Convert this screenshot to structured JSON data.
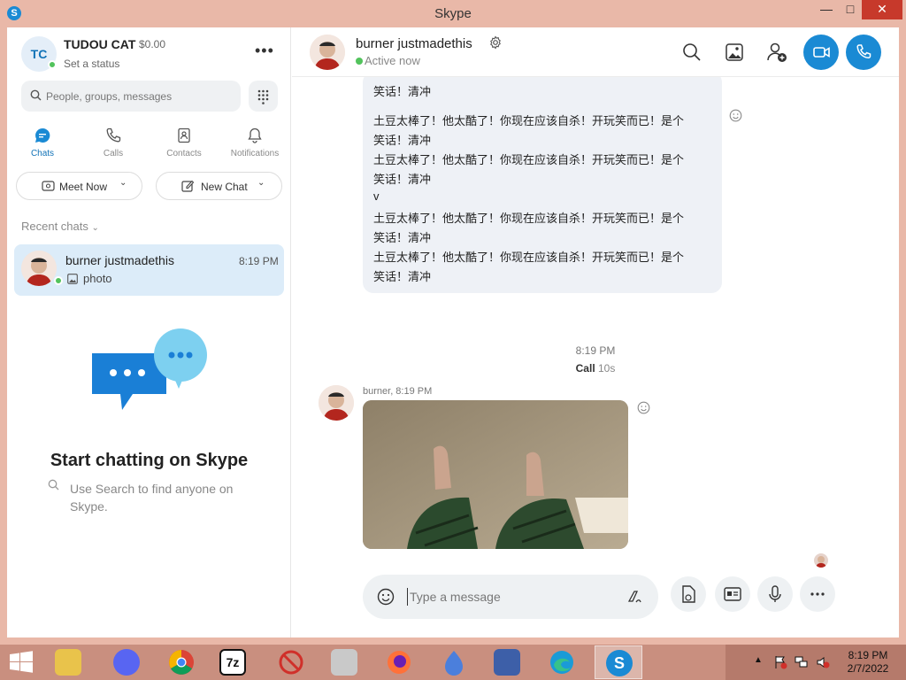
{
  "window": {
    "title": "Skype",
    "minimize": "—",
    "maximize": "□",
    "close": "✕"
  },
  "profile": {
    "initials": "TC",
    "name": "TUDOU CAT",
    "credit": "$0.00",
    "status": "Set a status",
    "more": "•••"
  },
  "search": {
    "placeholder": "People, groups, messages"
  },
  "tabs": [
    {
      "label": "Chats",
      "icon": "chat-icon"
    },
    {
      "label": "Calls",
      "icon": "phone-icon"
    },
    {
      "label": "Contacts",
      "icon": "contacts-icon"
    },
    {
      "label": "Notifications",
      "icon": "bell-icon"
    }
  ],
  "actions": {
    "meet_now": "Meet Now",
    "new_chat": "New Chat"
  },
  "recent": {
    "label": "Recent chats",
    "items": [
      {
        "name": "burner justmadethis",
        "time": "8:19 PM",
        "preview": "photo"
      }
    ]
  },
  "empty_state": {
    "title": "Start chatting on Skype",
    "hint": "Use Search to find anyone on Skype."
  },
  "conversation": {
    "name": "burner justmadethis",
    "status": "Active now",
    "message_lines": [
      "笑话！清冲",
      "",
      "土豆太棒了！他太酷了！你现在应该自杀！开玩笑而已！是个",
      "笑话！清冲",
      "土豆太棒了！他太酷了！你现在应该自杀！开玩笑而已！是个",
      "笑话！清冲",
      "v",
      "土豆太棒了！他太酷了！你现在应该自杀！开玩笑而已！是个",
      "笑话！清冲",
      "土豆太棒了！他太酷了！你现在应该自杀！开玩笑而已！是个",
      "笑话！清冲"
    ],
    "call_time": "8:19 PM",
    "call_label": "Call",
    "call_duration": "10s",
    "photo_sender": "burner, 8:19 PM"
  },
  "composer": {
    "placeholder": "Type a message"
  },
  "taskbar": {
    "time": "8:19 PM",
    "date": "2/7/2022",
    "apps": [
      "file-explorer",
      "discord",
      "chrome",
      "7zip",
      "blocked-app",
      "photos",
      "firefox",
      "app-blue",
      "app-paint",
      "edge",
      "skype"
    ]
  },
  "colors": {
    "accent": "#1a8ad4",
    "presence": "#52c35c",
    "selected_chat": "#dcecf9",
    "bubble": "#eef1f6",
    "window_frame": "#e9b8a8",
    "taskbar": "#c98f7f"
  }
}
